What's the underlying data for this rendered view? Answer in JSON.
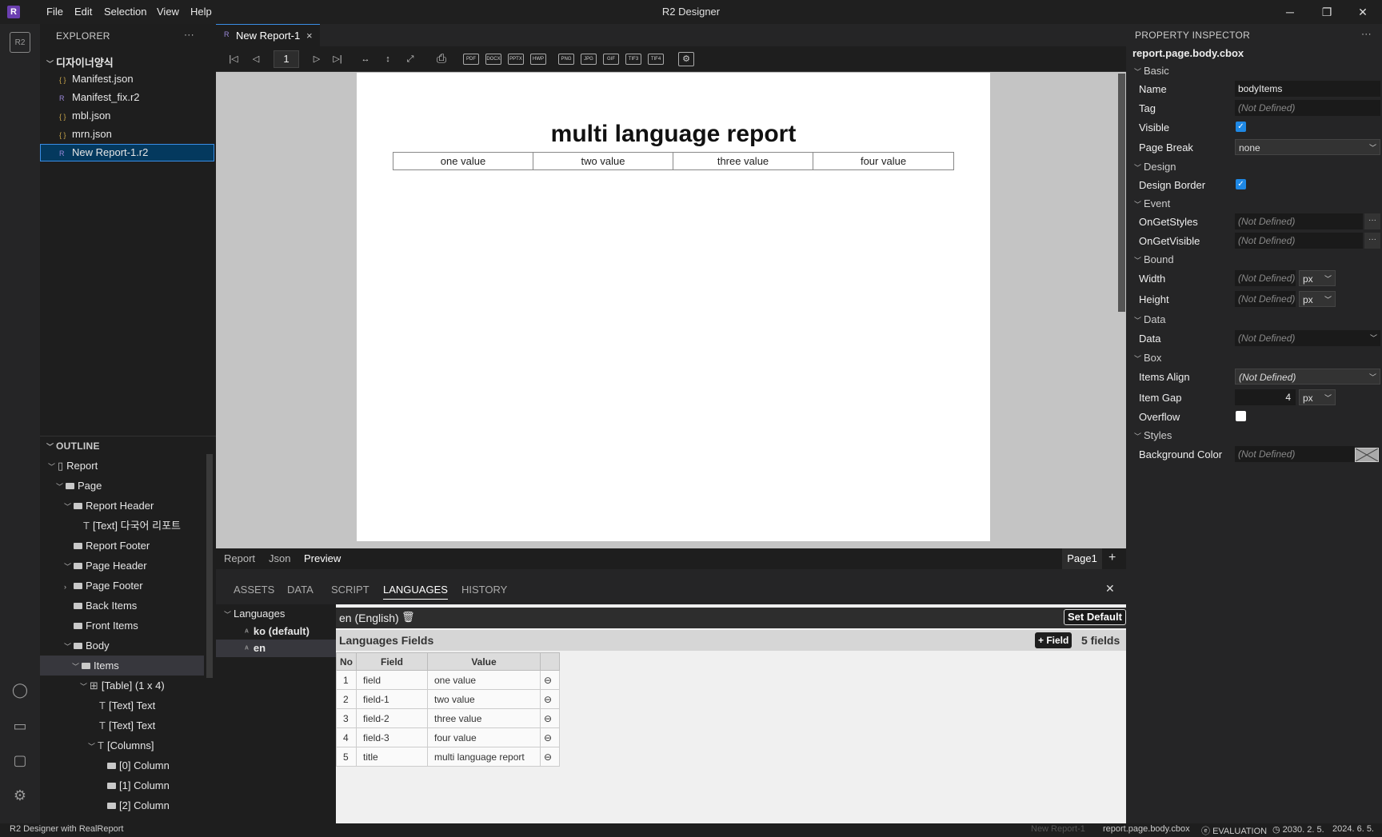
{
  "app": {
    "title": "R2 Designer",
    "logo": "R"
  },
  "menu": [
    "File",
    "Edit",
    "Selection",
    "View",
    "Help"
  ],
  "explorer": {
    "header": "EXPLORER",
    "more": "···",
    "folder": "디자이너양식",
    "files": [
      {
        "name": "Manifest.json",
        "icon": "json-file-icon",
        "glyph": "{ }"
      },
      {
        "name": "Manifest_fix.r2",
        "icon": "report-file-icon",
        "glyph": "R"
      },
      {
        "name": "mbl.json",
        "icon": "json-file-icon",
        "glyph": "{ }"
      },
      {
        "name": "mrn.json",
        "icon": "json-file-icon",
        "glyph": "{ }"
      },
      {
        "name": "New Report-1.r2",
        "icon": "report-file-icon",
        "glyph": "R"
      }
    ]
  },
  "outline": {
    "header": "OUTLINE",
    "items": {
      "report": "Report",
      "page": "Page",
      "report_header": "Report Header",
      "text_ko": "[Text] 다국어 리포트",
      "report_footer": "Report Footer",
      "page_header": "Page Header",
      "page_footer": "Page Footer",
      "back_items": "Back Items",
      "front_items": "Front Items",
      "body": "Body",
      "items": "Items",
      "table": "[Table] (1 x 4)",
      "text1": "[Text] Text",
      "text2": "[Text] Text",
      "columns": "[Columns]",
      "col0": "[0] Column",
      "col1": "[1] Column",
      "col2": "[2] Column"
    }
  },
  "editor": {
    "tab": "New Report-1",
    "close": "×",
    "page_number": "1",
    "export_formats": [
      "PDF",
      "DOCX",
      "PPTX",
      "HWP",
      "PNG",
      "JPG",
      "GIF",
      "TIF3",
      "TIF4"
    ],
    "document": {
      "title": "multi language report",
      "cells": [
        "one value",
        "two value",
        "three value",
        "four value"
      ]
    },
    "view_tabs": [
      "Report",
      "Json",
      "Preview"
    ],
    "page_tab": "Page1",
    "add": "+"
  },
  "bottom": {
    "tabs": [
      "ASSETS",
      "DATA",
      "SCRIPT",
      "LANGUAGES",
      "HISTORY"
    ],
    "active_tab": "LANGUAGES",
    "close": "✕",
    "languages_tree": {
      "root": "Languages",
      "items": [
        "ko (default)",
        "en"
      ]
    },
    "selected_language": "en (English)",
    "set_default": "Set Default",
    "fields_title": "Languages Fields",
    "add_field": "+ Field",
    "field_count": "5 fields",
    "columns": [
      "No",
      "Field",
      "Value"
    ],
    "rows": [
      {
        "no": "1",
        "field": "field",
        "value": "one value"
      },
      {
        "no": "2",
        "field": "field-1",
        "value": "two value"
      },
      {
        "no": "3",
        "field": "field-2",
        "value": "three value"
      },
      {
        "no": "4",
        "field": "field-3",
        "value": "four value"
      },
      {
        "no": "5",
        "field": "title",
        "value": "multi language report"
      }
    ]
  },
  "inspector": {
    "header": "PROPERTY INSPECTOR",
    "more": "···",
    "path": "report.page.body.cbox",
    "sections": {
      "basic": "Basic",
      "design": "Design",
      "event": "Event",
      "bound": "Bound",
      "data": "Data",
      "box": "Box",
      "styles": "Styles"
    },
    "props": {
      "name_label": "Name",
      "name_value": "bodyItems",
      "tag_label": "Tag",
      "tag_value": "(Not Defined)",
      "visible_label": "Visible",
      "pagebreak_label": "Page Break",
      "pagebreak_value": "none",
      "designborder_label": "Design Border",
      "ongetstyles_label": "OnGetStyles",
      "ongetstyles_value": "(Not Defined)",
      "ongetvisible_label": "OnGetVisible",
      "ongetvisible_value": "(Not Defined)",
      "width_label": "Width",
      "width_value": "(Not Defined)",
      "width_unit": "px",
      "height_label": "Height",
      "height_value": "(Not Defined)",
      "height_unit": "px",
      "data_label": "Data",
      "data_value": "(Not Defined)",
      "itemsalign_label": "Items Align",
      "itemsalign_value": "(Not Defined)",
      "itemgap_label": "Item Gap",
      "itemgap_value": "4",
      "itemgap_unit": "px",
      "overflow_label": "Overflow",
      "bgcolor_label": "Background Color",
      "bgcolor_value": "(Not Defined)",
      "ellipsis": "···"
    }
  },
  "status": {
    "left": "R2 Designer with RealReport",
    "file": "New Report-1",
    "path": "report.page.body.cbox",
    "mode": "EVALUATION",
    "date1": "2030. 2. 5.",
    "date2": "2024. 6. 5."
  },
  "colors": {
    "accent": "#0e639c",
    "checkbox": "#1e88e5",
    "selected_file": "#04395e"
  }
}
